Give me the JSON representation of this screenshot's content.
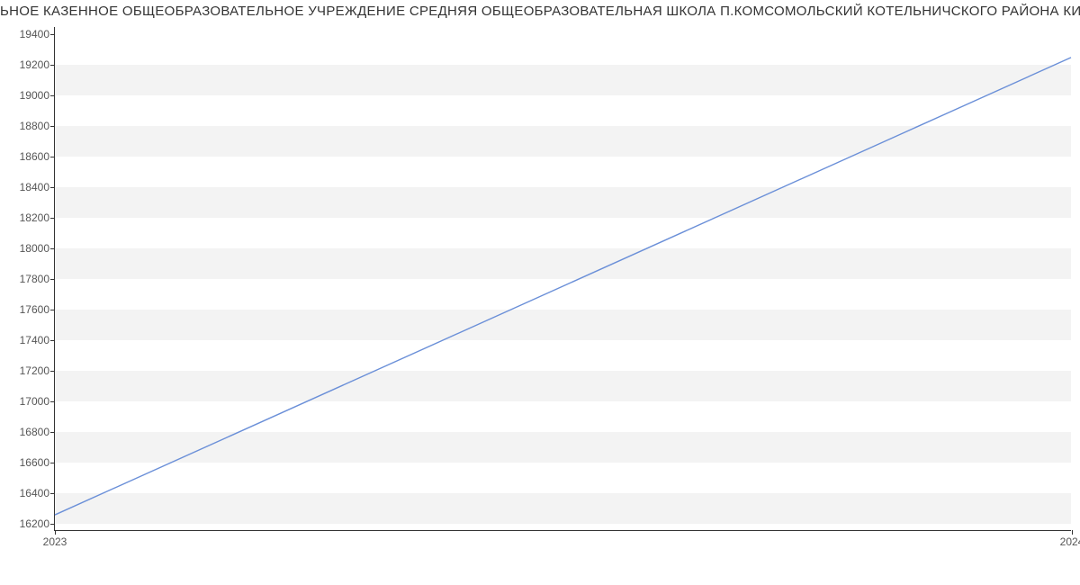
{
  "chart_data": {
    "type": "line",
    "title": "ЬНОЕ КАЗЕННОЕ ОБЩЕОБРАЗОВАТЕЛЬНОЕ УЧРЕЖДЕНИЕ СРЕДНЯЯ ОБЩЕОБРАЗОВАТЕЛЬНАЯ ШКОЛА П.КОМСОМОЛЬСКИЙ КОТЕЛЬНИЧСКОГО РАЙОНА КИРОВСКОЙ ОБЛА",
    "x": [
      2023,
      2024
    ],
    "series": [
      {
        "name": "",
        "values": [
          16250,
          19250
        ],
        "color": "#6a8fd8"
      }
    ],
    "y_ticks": [
      16200,
      16400,
      16600,
      16800,
      17000,
      17200,
      17400,
      17600,
      17800,
      18000,
      18200,
      18400,
      18600,
      18800,
      19000,
      19200,
      19400
    ],
    "x_ticks": [
      2023,
      2024
    ],
    "ylim": [
      16150,
      19450
    ],
    "xlabel": "",
    "ylabel": ""
  }
}
